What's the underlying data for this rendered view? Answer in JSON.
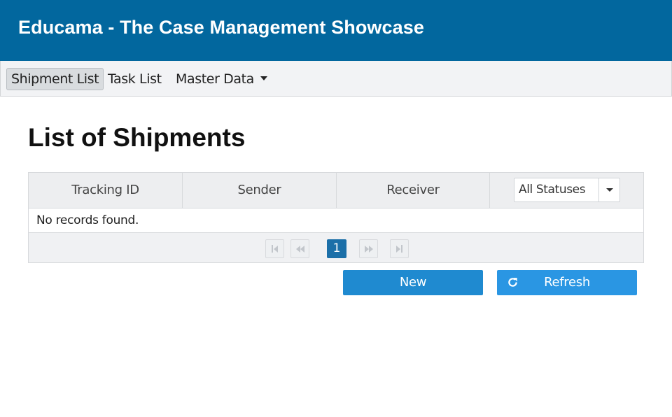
{
  "header": {
    "title": "Educama - The Case Management Showcase",
    "background": "#02679e"
  },
  "menu": {
    "items": [
      {
        "label": "Shipment List",
        "active": true
      },
      {
        "label": "Task List",
        "active": false
      },
      {
        "label": "Master Data",
        "active": false,
        "has_dropdown": true
      }
    ]
  },
  "page": {
    "title": "List of Shipments"
  },
  "table": {
    "columns": [
      "Tracking ID",
      "Sender",
      "Receiver"
    ],
    "status_filter": {
      "selected": "All Statuses",
      "icon": "chevron-down-icon"
    },
    "empty_message": "No records found.",
    "paginator": {
      "first_icon": "first-page-icon",
      "prev_icon": "prev-page-icon",
      "current_page": "1",
      "next_icon": "next-page-icon",
      "last_icon": "last-page-icon"
    }
  },
  "actions": {
    "new_label": "New",
    "refresh_label": "Refresh",
    "refresh_icon": "refresh-icon",
    "button_color": "#1f8ad0"
  }
}
